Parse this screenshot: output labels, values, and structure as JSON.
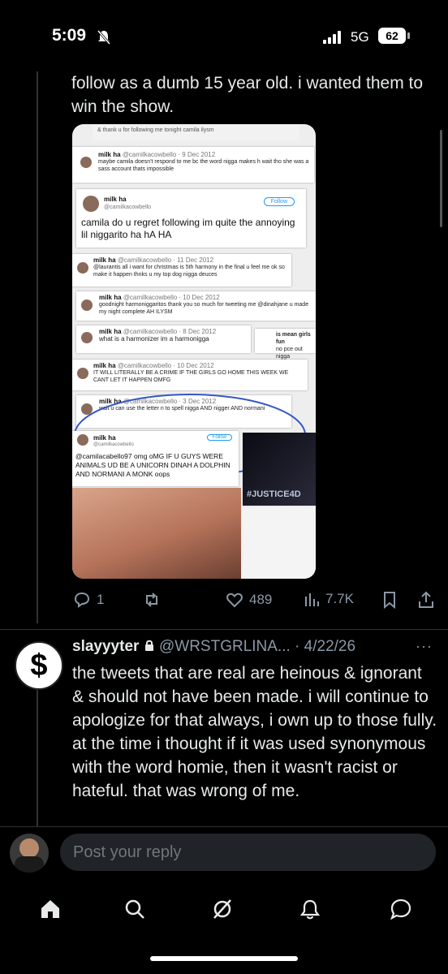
{
  "status": {
    "time": "5:09",
    "network": "5G",
    "battery": "62"
  },
  "post": {
    "text_tail": "follow as a dumb 15 year old. i wanted them to win the show.",
    "media": {
      "top_caption": "& thank u for following me tonight camila ilysm",
      "tweets": [
        {
          "name": "milk ha",
          "handle": "@camilkacowbello · 9 Dec 2012",
          "text": "maybe camila doesn't respond to me bc the word nigga makes h wait tho she was a sass account thats impossible"
        },
        {
          "name": "milk ha",
          "handle": "@camilkacowbello",
          "follow": "Follow",
          "text": "camila do u regret following im quite the annoying lil niggarito ha hA HA"
        },
        {
          "name": "milk ha",
          "handle": "@camilkacowbello · 11 Dec 2012",
          "text": "@laurantis all i want for christmas is 5th harmony in the final u feel me ok so make it happen thnks u my top dog nigga deuces"
        },
        {
          "name": "milk ha",
          "handle": "@camilkacowbello · 10 Dec 2012",
          "text": "goodnight harmoniggaritos thank you so much for tweeting me @dinahjane u made my night complete AH ILYSM"
        },
        {
          "name": "milk ha",
          "handle": "@camilkacowbello · 8 Dec 2012",
          "text": "what is a harmonizer im a harmonigga"
        },
        {
          "name": "milk ha",
          "handle": "@camilkacowbello · 10 Dec 2012",
          "text": "IT WILL LITERALLY BE A CRIME IF THE GIRLS GO HOME THIS WEEK WE CANT LET IT HAPPEN OMFG"
        },
        {
          "name": "milk ha",
          "handle": "@camilkacowbello · 3 Dec 2012",
          "text": "wait u can use the letter n to spell nigga AND nigger AND normani"
        },
        {
          "name": "milk ha",
          "handle": "@camilkacowbello",
          "follow": "Follow",
          "text": "@camilacabello97 omg oMG IF U GUYS WERE ANIMALS UD BE A UNICORN DINAH A DOLPHIN AND NORMANI A MONK oops"
        }
      ],
      "side_text_1": "is mean girls fun",
      "side_text_2": "no pce out nigga",
      "hashtag": "#JUSTICE4D"
    },
    "actions": {
      "replies": "1",
      "likes": "489",
      "views": "7.7K"
    }
  },
  "reply": {
    "name": "slayyyter",
    "handle": "@WRSTGRLINA...",
    "date": "· 4/22/26",
    "text": "the tweets that are real are heinous & ignorant & should not have been made. i will continue to apologize for that always, i own up to those fully. at the time i thought if it was used synonymous with the word homie, then it wasn't racist or hateful. that was wrong of me."
  },
  "composer": {
    "placeholder": "Post your reply"
  },
  "colors": {
    "background": "#000000",
    "text": "#e7e9ea",
    "muted": "#8b98a5",
    "highlight": "#d8c8f0"
  }
}
